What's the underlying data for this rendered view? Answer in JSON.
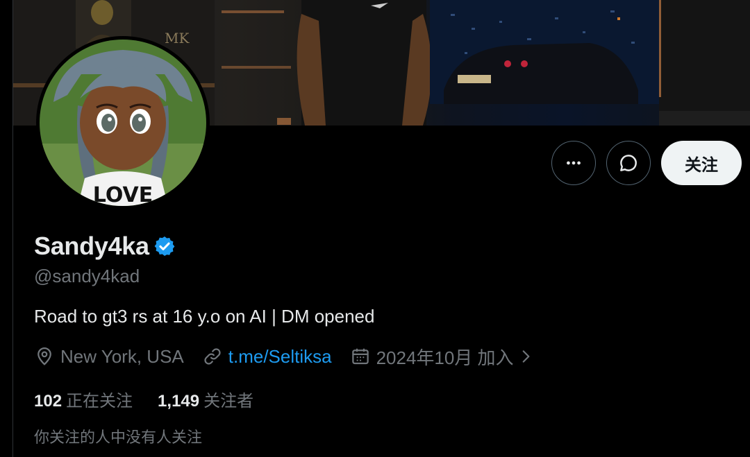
{
  "profile": {
    "display_name": "Sandy4ka",
    "handle": "@sandy4kad",
    "bio": "Road to gt3 rs at 16 y.o on AI | DM opened",
    "location": "New York, USA",
    "website": "t.me/Seltiksa",
    "joined": "2024年10月 加入",
    "avatar_shirt_text": "LOVE"
  },
  "actions": {
    "more_icon": "more-horizontal-icon",
    "dm_icon": "message-bubble-icon",
    "follow_label": "关注"
  },
  "stats": {
    "following_count": "102",
    "following_label": "正在关注",
    "followers_count": "1,149",
    "followers_label": "关注者"
  },
  "note": "你关注的人中没有人关注",
  "colors": {
    "background": "#000000",
    "accent": "#1d9bf0",
    "muted_text": "#71767b",
    "primary_text": "#e7e9ea",
    "follow_button_bg": "#eff3f4"
  }
}
